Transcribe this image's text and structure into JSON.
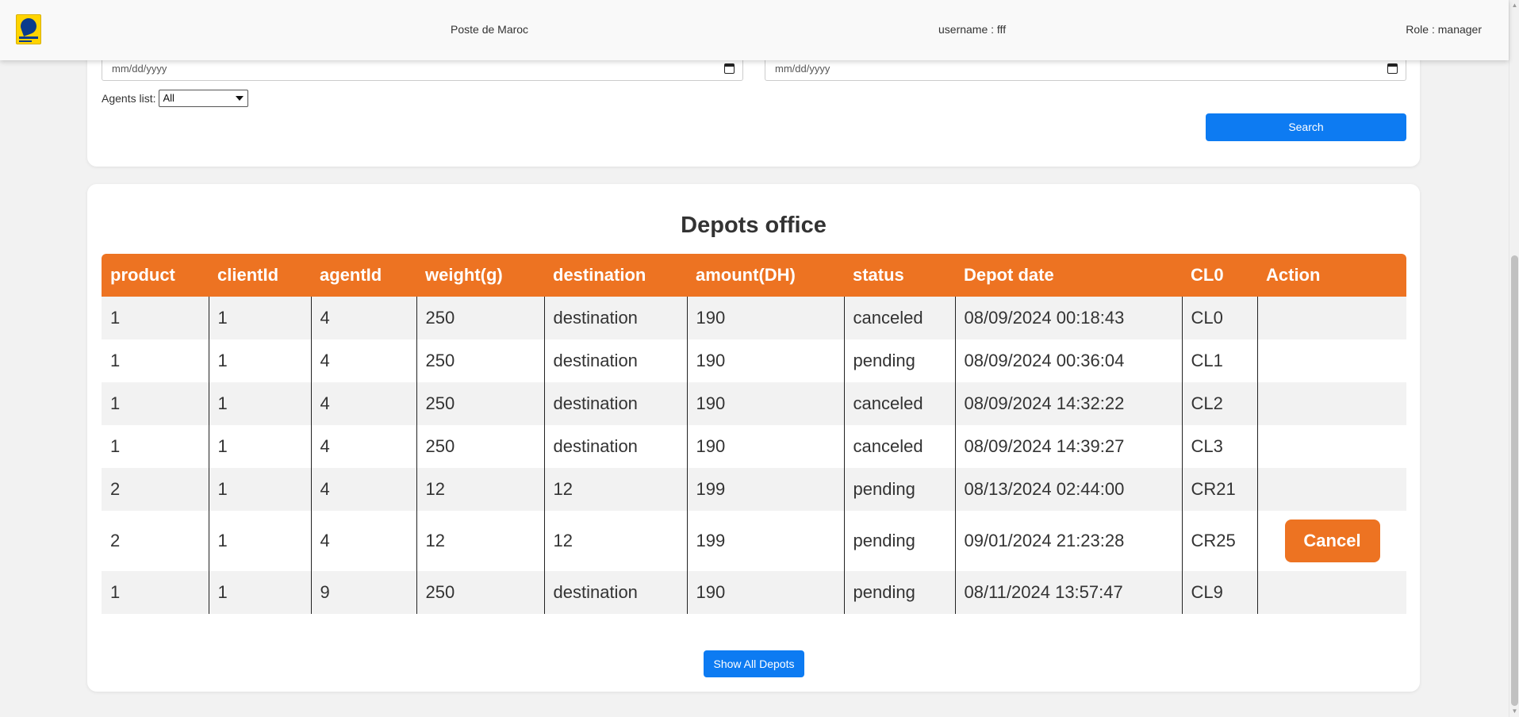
{
  "header": {
    "brand": "Poste de Maroc",
    "username": "username : fff",
    "role": "Role : manager"
  },
  "filters": {
    "date_from_placeholder": "mm/dd/yyyy",
    "date_to_placeholder": "mm/dd/yyyy",
    "agents_label": "Agents list:",
    "agents_selected": "All",
    "search_label": "Search"
  },
  "depots": {
    "title": "Depots office",
    "columns": [
      "product",
      "clientId",
      "agentId",
      "weight(g)",
      "destination",
      "amount(DH)",
      "status",
      "Depot date",
      "CL0",
      "Action"
    ],
    "rows": [
      {
        "product": "1",
        "clientId": "1",
        "agentId": "4",
        "weight": "250",
        "destination": "destination",
        "amount": "190",
        "status": "canceled",
        "date": "08/09/2024 00:18:43",
        "code": "CL0",
        "action": ""
      },
      {
        "product": "1",
        "clientId": "1",
        "agentId": "4",
        "weight": "250",
        "destination": "destination",
        "amount": "190",
        "status": "pending",
        "date": "08/09/2024 00:36:04",
        "code": "CL1",
        "action": ""
      },
      {
        "product": "1",
        "clientId": "1",
        "agentId": "4",
        "weight": "250",
        "destination": "destination",
        "amount": "190",
        "status": "canceled",
        "date": "08/09/2024 14:32:22",
        "code": "CL2",
        "action": ""
      },
      {
        "product": "1",
        "clientId": "1",
        "agentId": "4",
        "weight": "250",
        "destination": "destination",
        "amount": "190",
        "status": "canceled",
        "date": "08/09/2024 14:39:27",
        "code": "CL3",
        "action": ""
      },
      {
        "product": "2",
        "clientId": "1",
        "agentId": "4",
        "weight": "12",
        "destination": "12",
        "amount": "199",
        "status": "pending",
        "date": "08/13/2024 02:44:00",
        "code": "CR21",
        "action": ""
      },
      {
        "product": "2",
        "clientId": "1",
        "agentId": "4",
        "weight": "12",
        "destination": "12",
        "amount": "199",
        "status": "pending",
        "date": "09/01/2024 21:23:28",
        "code": "CR25",
        "action": "Cancel"
      },
      {
        "product": "1",
        "clientId": "1",
        "agentId": "9",
        "weight": "250",
        "destination": "destination",
        "amount": "190",
        "status": "pending",
        "date": "08/11/2024 13:57:47",
        "code": "CL9",
        "action": ""
      }
    ],
    "show_all_label": "Show All Depots"
  },
  "colors": {
    "accent_orange": "#ed7322",
    "primary_blue": "#0d7bf2"
  }
}
